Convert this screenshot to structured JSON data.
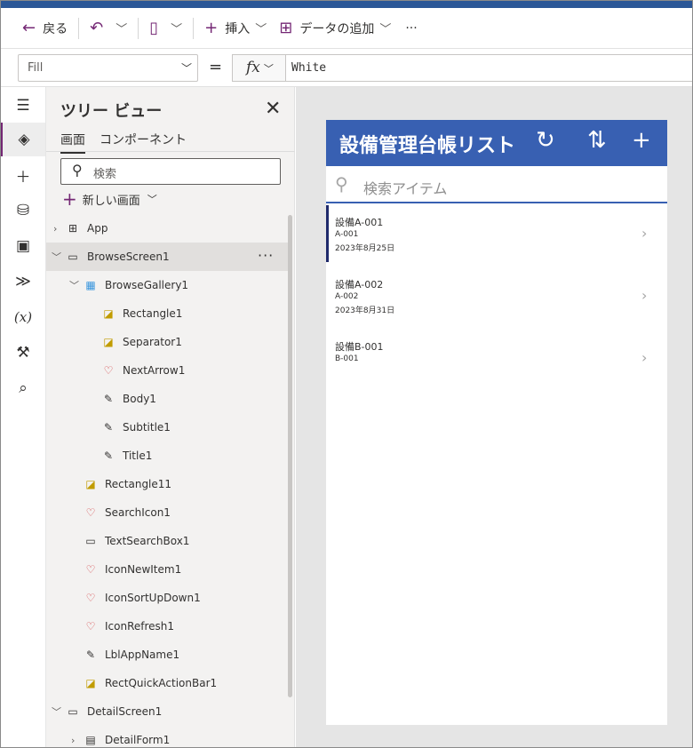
{
  "toolbar": {
    "back": "戻る",
    "insert": "挿入",
    "add_data": "データの追加",
    "more": "···"
  },
  "formula_bar": {
    "property": "Fill",
    "equals": "=",
    "fx": "fx",
    "value": "White"
  },
  "tree": {
    "title": "ツリー ビュー",
    "tabs": [
      "画面",
      "コンポーネント"
    ],
    "search_placeholder": "検索",
    "new_screen": "新しい画面",
    "nodes": [
      {
        "label": "App",
        "icon": "app-icon"
      },
      {
        "label": "BrowseScreen1",
        "icon": "screen-icon",
        "selected": true
      },
      {
        "label": "BrowseGallery1",
        "icon": "gallery-icon"
      },
      {
        "label": "Rectangle1",
        "icon": "shape-icon"
      },
      {
        "label": "Separator1",
        "icon": "shape-icon"
      },
      {
        "label": "NextArrow1",
        "icon": "icon-control-icon"
      },
      {
        "label": "Body1",
        "icon": "label-icon"
      },
      {
        "label": "Subtitle1",
        "icon": "label-icon"
      },
      {
        "label": "Title1",
        "icon": "label-icon"
      },
      {
        "label": "Rectangle11",
        "icon": "shape-icon"
      },
      {
        "label": "SearchIcon1",
        "icon": "icon-control-icon"
      },
      {
        "label": "TextSearchBox1",
        "icon": "text-input-icon"
      },
      {
        "label": "IconNewItem1",
        "icon": "icon-control-icon"
      },
      {
        "label": "IconSortUpDown1",
        "icon": "icon-control-icon"
      },
      {
        "label": "IconRefresh1",
        "icon": "icon-control-icon"
      },
      {
        "label": "LblAppName1",
        "icon": "label-icon"
      },
      {
        "label": "RectQuickActionBar1",
        "icon": "shape-icon"
      },
      {
        "label": "DetailScreen1",
        "icon": "screen-icon"
      },
      {
        "label": "DetailForm1",
        "icon": "form-icon"
      }
    ]
  },
  "app_preview": {
    "title": "設備管理台帳リスト",
    "search_placeholder": "検索アイテム",
    "items": [
      {
        "title": "設備A-001",
        "subtitle": "A-001",
        "body": "2023年8月25日"
      },
      {
        "title": "設備A-002",
        "subtitle": "A-002",
        "body": "2023年8月31日"
      },
      {
        "title": "設備B-001",
        "subtitle": "B-001",
        "body": ""
      }
    ]
  },
  "colors": {
    "accent": "#742774",
    "app_header": "#3860b2",
    "selected_row": "#e1dfdd"
  }
}
